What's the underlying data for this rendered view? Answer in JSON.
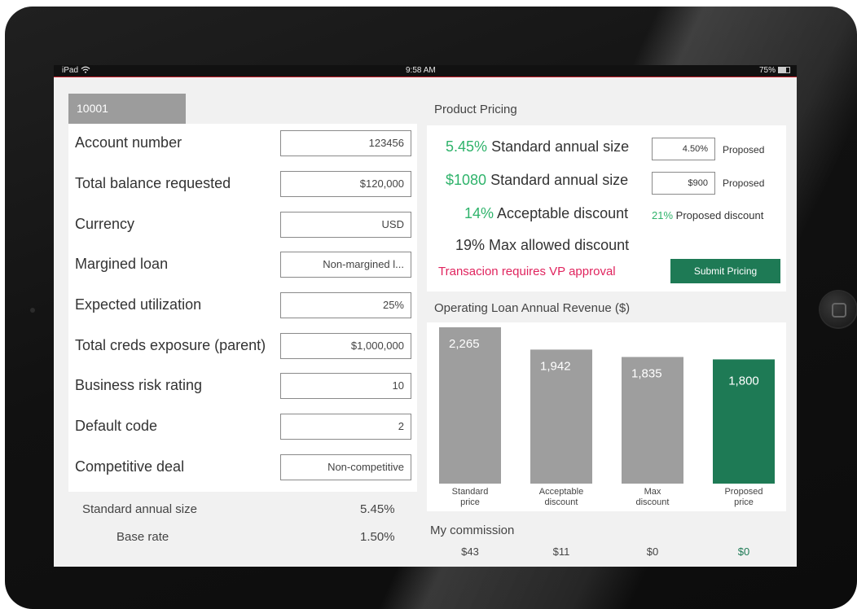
{
  "status_bar": {
    "device": "iPad",
    "wifi_icon": "wifi-icon",
    "time": "9:58 AM",
    "battery": "75%"
  },
  "account_tab": "10001",
  "form": {
    "rows": [
      {
        "label": "Account number",
        "value": "123456"
      },
      {
        "label": "Total balance requested",
        "value": "$120,000"
      },
      {
        "label": "Currency",
        "value": "USD"
      },
      {
        "label": "Margined loan",
        "value": "Non-margined l..."
      },
      {
        "label": "Expected utilization",
        "value": "25%"
      },
      {
        "label": "Total creds exposure (parent)",
        "value": "$1,000,000"
      },
      {
        "label": "Business risk rating",
        "value": "10"
      },
      {
        "label": "Default code",
        "value": "2"
      },
      {
        "label": "Competitive deal",
        "value": "Non-competitive"
      }
    ]
  },
  "stats": {
    "standard_annual_size_label": "Standard annual size",
    "standard_annual_size_value": "5.45%",
    "base_rate_label": "Base rate",
    "base_rate_value": "1.50%"
  },
  "pricing": {
    "title": "Product Pricing",
    "row1": {
      "value": "5.45%",
      "label": "Standard annual size",
      "input": "4.50%",
      "tag": "Proposed"
    },
    "row2": {
      "value": "$1080",
      "label": "Standard annual size",
      "input": "$900",
      "tag": "Proposed"
    },
    "row3": {
      "value": "14%",
      "label": "Acceptable discount",
      "proposed_value": "21%",
      "proposed_label": "Proposed discount"
    },
    "row4": {
      "text": "19% Max allowed discount"
    },
    "warning": "Transacion requires VP approval",
    "submit_label": "Submit Pricing"
  },
  "chart_title": "Operating Loan Annual Revenue ($)",
  "chart_data": {
    "type": "bar",
    "title": "Operating Loan Annual Revenue ($)",
    "categories": [
      [
        "Standard",
        "price"
      ],
      [
        "Acceptable",
        "discount"
      ],
      [
        "Max",
        "discount"
      ],
      [
        "Proposed",
        "price"
      ]
    ],
    "values": [
      2265,
      1942,
      1835,
      1800
    ],
    "value_labels": [
      "2,265",
      "1,942",
      "1,835",
      "1,800"
    ],
    "colors": [
      "#9e9e9e",
      "#9e9e9e",
      "#9e9e9e",
      "#1e7a55"
    ],
    "ylim": [
      0,
      2265
    ]
  },
  "commission": {
    "title": "My commission",
    "values": [
      "$43",
      "$11",
      "$0",
      "$0"
    ],
    "colors": [
      "#444444",
      "#444444",
      "#444444",
      "#1e7a55"
    ]
  }
}
